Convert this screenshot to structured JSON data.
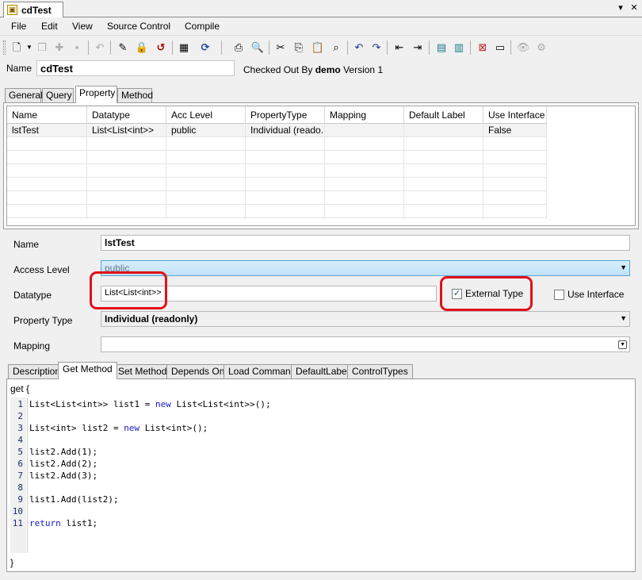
{
  "document": {
    "tab_title": "cdTest",
    "tab_icon": "class-file-icon",
    "dropdown_glyph": "▾",
    "close_glyph": "✕"
  },
  "menu": [
    "File",
    "Edit",
    "View",
    "Source Control",
    "Compile"
  ],
  "name_row": {
    "label": "Name",
    "value": "cdTest",
    "checked_out_prefix": "Checked Out By",
    "checked_out_user": "demo",
    "version": "Version 1"
  },
  "main_tabs": [
    {
      "label": "General",
      "active": false
    },
    {
      "label": "Query",
      "active": false
    },
    {
      "label": "Property",
      "active": true
    },
    {
      "label": "Method",
      "active": false
    }
  ],
  "grid": {
    "columns": [
      "Name",
      "Datatype",
      "Acc Level",
      "PropertyType",
      "Mapping",
      "Default Label",
      "Use Interface"
    ],
    "rows": [
      [
        "lstTest",
        "List<List<int>>",
        "public",
        "Individual (reado...",
        "",
        "",
        "False"
      ]
    ]
  },
  "form": {
    "name_label": "Name",
    "name_value": "lstTest",
    "access_label": "Access Level",
    "access_value": "public",
    "datatype_label": "Datatype",
    "datatype_value": "List<List<int>>",
    "external_type_label": "External Type",
    "external_type_checked": true,
    "use_interface_label": "Use Interface",
    "use_interface_checked": false,
    "property_type_label": "Property Type",
    "property_type_value": "Individual (readonly)",
    "mapping_label": "Mapping",
    "mapping_value": ""
  },
  "code_tabs": [
    {
      "label": "Description",
      "active": false
    },
    {
      "label": "Get Method",
      "active": true
    },
    {
      "label": "Set Method",
      "active": false
    },
    {
      "label": "Depends On",
      "active": false
    },
    {
      "label": "Load Command",
      "active": false
    },
    {
      "label": "DefaultLabel",
      "active": false
    },
    {
      "label": "ControlTypes",
      "active": false
    }
  ],
  "code": {
    "header": "get {",
    "footer": "}",
    "lines": [
      {
        "n": "1",
        "text": "List<List<int>> list1 = new List<List<int>>();"
      },
      {
        "n": "2",
        "text": ""
      },
      {
        "n": "3",
        "text": "List<int> list2 = new List<int>();"
      },
      {
        "n": "4",
        "text": ""
      },
      {
        "n": "5",
        "text": "list2.Add(1);"
      },
      {
        "n": "6",
        "text": "list2.Add(2);"
      },
      {
        "n": "7",
        "text": "list2.Add(3);"
      },
      {
        "n": "8",
        "text": ""
      },
      {
        "n": "9",
        "text": "list1.Add(list2);"
      },
      {
        "n": "10",
        "text": ""
      },
      {
        "n": "11",
        "text": "return list1;"
      }
    ]
  },
  "colors": {
    "highlight": "#e0101a",
    "keyword": "#1a1ac8",
    "selected_dropdown": "#bfe1f6"
  }
}
